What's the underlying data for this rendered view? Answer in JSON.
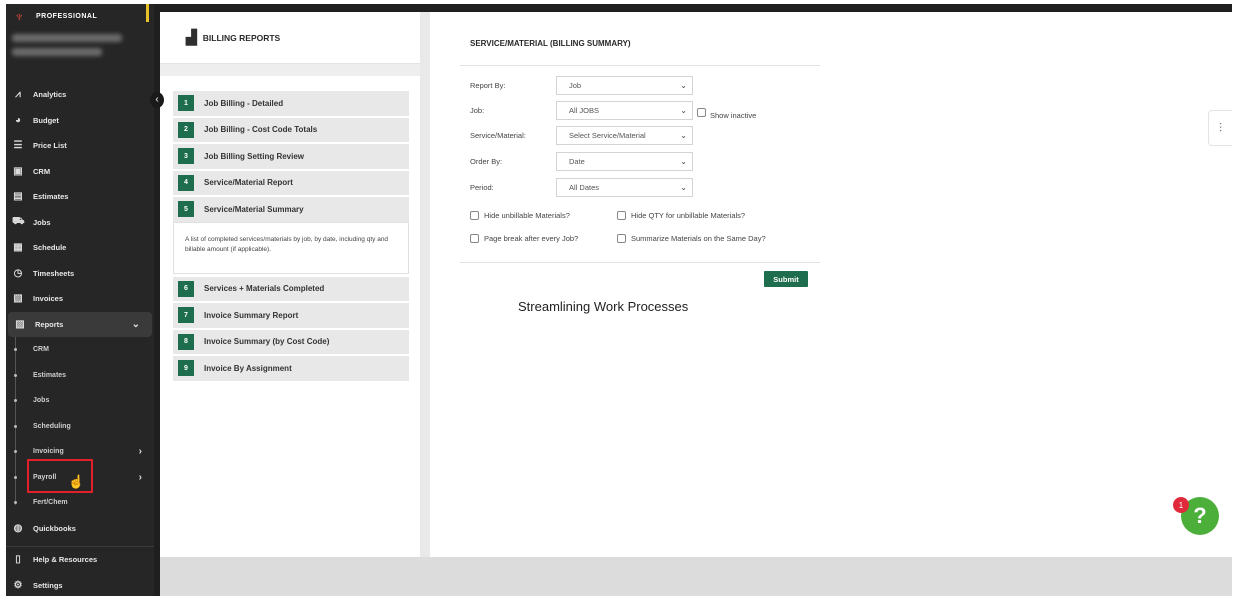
{
  "brand": {
    "name": "PROFESSIONAL",
    "logo_icon": "plant-logo-icon",
    "accent": "#e84a3c"
  },
  "sidebar": {
    "items": [
      {
        "label": "Analytics",
        "icon": "chart-line-icon"
      },
      {
        "label": "Budget",
        "icon": "pie-chart-icon"
      },
      {
        "label": "Price List",
        "icon": "list-icon"
      },
      {
        "label": "CRM",
        "icon": "contact-card-icon"
      },
      {
        "label": "Estimates",
        "icon": "document-icon"
      },
      {
        "label": "Jobs",
        "icon": "truck-icon"
      },
      {
        "label": "Schedule",
        "icon": "calendar-icon"
      },
      {
        "label": "Timesheets",
        "icon": "clock-icon"
      },
      {
        "label": "Invoices",
        "icon": "invoice-icon"
      },
      {
        "label": "Reports",
        "icon": "report-icon"
      }
    ],
    "reports_sub": [
      "CRM",
      "Estimates",
      "Jobs",
      "Scheduling",
      "Invoicing",
      "Payroll",
      "Fert/Chem"
    ],
    "bottom_items": [
      {
        "label": "Quickbooks",
        "icon": "quickbooks-icon"
      },
      {
        "label": "Help & Resources",
        "icon": "help-book-icon"
      },
      {
        "label": "Settings",
        "icon": "gear-icon"
      }
    ]
  },
  "left_panel": {
    "title": "BILLING REPORTS",
    "reports": [
      {
        "num": "1",
        "label": "Job Billing - Detailed"
      },
      {
        "num": "2",
        "label": "Job Billing - Cost Code Totals"
      },
      {
        "num": "3",
        "label": "Job Billing Setting Review"
      },
      {
        "num": "4",
        "label": "Service/Material Report"
      },
      {
        "num": "5",
        "label": "Service/Material Summary"
      },
      {
        "num": "6",
        "label": "Services + Materials Completed"
      },
      {
        "num": "7",
        "label": "Invoice Summary Report"
      },
      {
        "num": "8",
        "label": "Invoice Summary (by Cost Code)"
      },
      {
        "num": "9",
        "label": "Invoice By Assignment"
      }
    ],
    "selected_description": "A list of completed services/materials by job, by date, including qty and billable amount (if applicable)."
  },
  "form": {
    "title": "SERVICE/MATERIAL (BILLING SUMMARY)",
    "report_by": {
      "label": "Report By:",
      "value": "Job"
    },
    "job": {
      "label": "Job:",
      "value": "All JOBS"
    },
    "show_inactive": "Show inactive",
    "service_material": {
      "label": "Service/Material:",
      "value": "Select Service/Material"
    },
    "order_by": {
      "label": "Order By:",
      "value": "Date"
    },
    "period": {
      "label": "Period:",
      "value": "All Dates"
    },
    "checkboxes": {
      "hide_unbillable": "Hide unbillable Materials?",
      "hide_qty": "Hide QTY for unbillable Materials?",
      "page_break": "Page break after every Job?",
      "summarize": "Summarize Materials on the Same Day?"
    },
    "submit_label": "Submit"
  },
  "caption": "Streamlining Work Processes",
  "help": {
    "badge": "1",
    "symbol": "?"
  },
  "colors": {
    "brand_green": "#1f6d4f",
    "help_green": "#4caf3a",
    "highlight_red": "#e0202a"
  }
}
